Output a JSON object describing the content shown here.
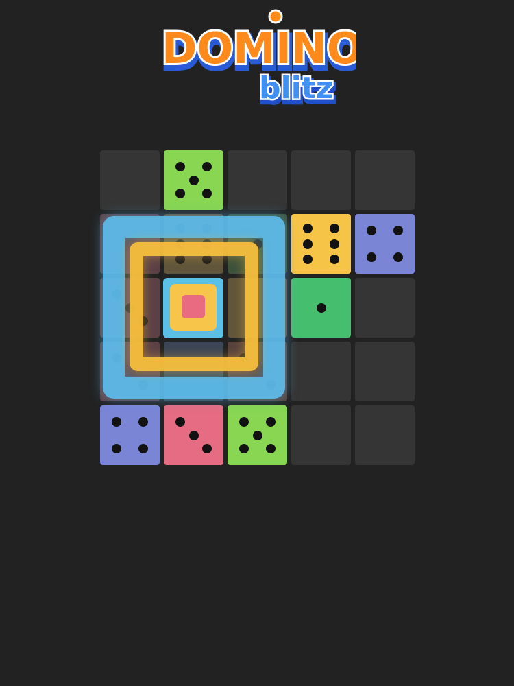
{
  "logo": {
    "line1": "DOMINO",
    "line2": "blitz",
    "colors": {
      "main": "#ff8a1c",
      "shadow": "#2a5bd7",
      "accent_text": "#2f7df0",
      "outline": "#ffffff"
    }
  },
  "board": {
    "rows": 5,
    "cols": 5,
    "colors": {
      "empty": "#353535",
      "green": "#88d652",
      "yellow": "#f6c446",
      "blue": "#7a85d6",
      "teal_green": "#45be6e",
      "pink": "#e56c82",
      "rose": "#e57c8c"
    },
    "cells": [
      [
        {
          "color": null,
          "pips": 0
        },
        {
          "color": "green",
          "pips": 5
        },
        {
          "color": null,
          "pips": 0
        },
        {
          "color": null,
          "pips": 0
        },
        {
          "color": null,
          "pips": 0
        }
      ],
      [
        {
          "color": "faded_pink",
          "pips": 0,
          "faded": true
        },
        {
          "color": "faded_yellow",
          "pips": 6,
          "faded": true
        },
        {
          "color": "faded_green",
          "pips": 1,
          "faded": true
        },
        {
          "color": "yellow",
          "pips": 6
        },
        {
          "color": "blue",
          "pips": 4
        }
      ],
      [
        {
          "color": "faded_pink",
          "pips": 3,
          "faded": true
        },
        {
          "color": null,
          "pips": 0
        },
        {
          "color": "faded_yellow",
          "pips": 0,
          "faded": true
        },
        {
          "color": "teal_green",
          "pips": 1
        },
        {
          "color": null,
          "pips": 0
        }
      ],
      [
        {
          "color": "faded_pink",
          "pips": 2,
          "faded": true
        },
        {
          "color": "faded_blue",
          "pips": 0,
          "faded": true
        },
        {
          "color": "faded_rose",
          "pips": 2,
          "faded": true
        },
        {
          "color": null,
          "pips": 0
        },
        {
          "color": null,
          "pips": 0
        }
      ],
      [
        {
          "color": "blue",
          "pips": 4
        },
        {
          "color": "pink",
          "pips": 3
        },
        {
          "color": "green",
          "pips": 5
        },
        {
          "color": null,
          "pips": 0
        },
        {
          "color": null,
          "pips": 0
        }
      ]
    ]
  },
  "merge_effect": {
    "colors": [
      "#5dbeee",
      "#f8c03e",
      "#e86b82"
    ]
  }
}
